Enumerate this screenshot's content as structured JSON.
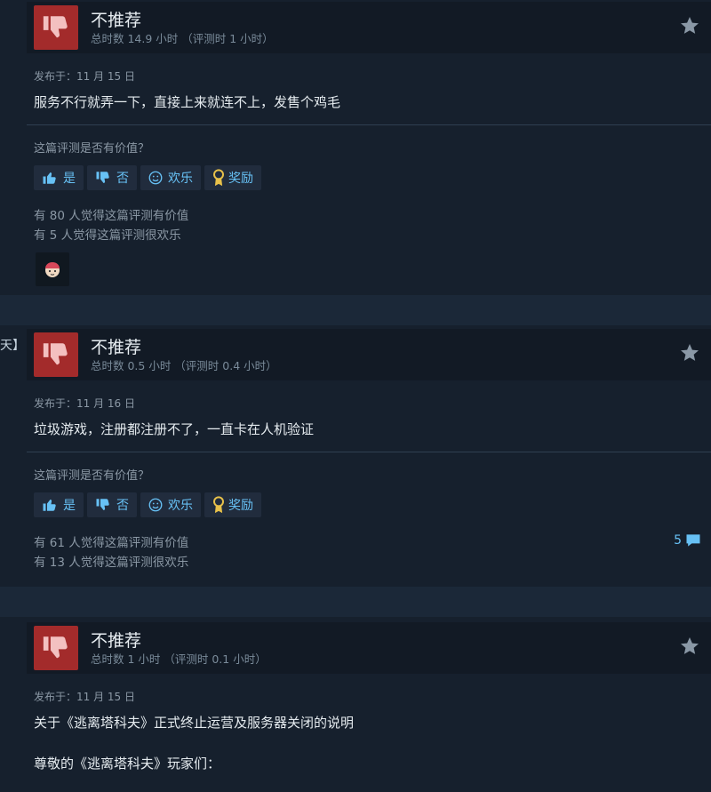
{
  "reviews": [
    {
      "verdict": "不推荐",
      "hours": "总时数 14.9 小时 （评测时 1 小时）",
      "posted": "发布于：11 月 15 日",
      "body": "服务不行就弄一下，直接上来就连不上，发售个鸡毛",
      "helpful_q": "这篇评测是否有价值？",
      "buttons": {
        "yes": "是",
        "no": "否",
        "funny": "欢乐",
        "award": "奖励"
      },
      "stat_helpful": "有 80 人觉得这篇评测有价值",
      "stat_funny": "有 5 人觉得这篇评测很欢乐"
    },
    {
      "verdict": "不推荐",
      "hours": "总时数 0.5 小时 （评测时 0.4 小时）",
      "posted": "发布于：11 月 16 日",
      "body": "垃圾游戏，注册都注册不了，一直卡在人机验证",
      "helpful_q": "这篇评测是否有价值？",
      "buttons": {
        "yes": "是",
        "no": "否",
        "funny": "欢乐",
        "award": "奖励"
      },
      "stat_helpful": "有 61 人觉得这篇评测有价值",
      "stat_funny": "有 13 人觉得这篇评测很欢乐",
      "comment_count": "5"
    },
    {
      "verdict": "不推荐",
      "hours": "总时数 1 小时 （评测时 0.1 小时）",
      "posted": "发布于：11 月 15 日",
      "body": "关于《逃离塔科夫》正式终止运营及服务器关闭的说明",
      "body2": "尊敬的《逃离塔科夫》玩家们："
    }
  ],
  "edge_text": "天】",
  "icons": [
    "thumbs-down-icon",
    "star-icon",
    "thumbs-up-icon",
    "smiley-icon",
    "award-icon",
    "comment-icon",
    "emoji-award-icon"
  ],
  "colors": {
    "background": "#1b2838",
    "card": "#16202d",
    "header": "#121a25",
    "thumb_red": "#a32b2b",
    "link_blue": "#67c1f5"
  }
}
